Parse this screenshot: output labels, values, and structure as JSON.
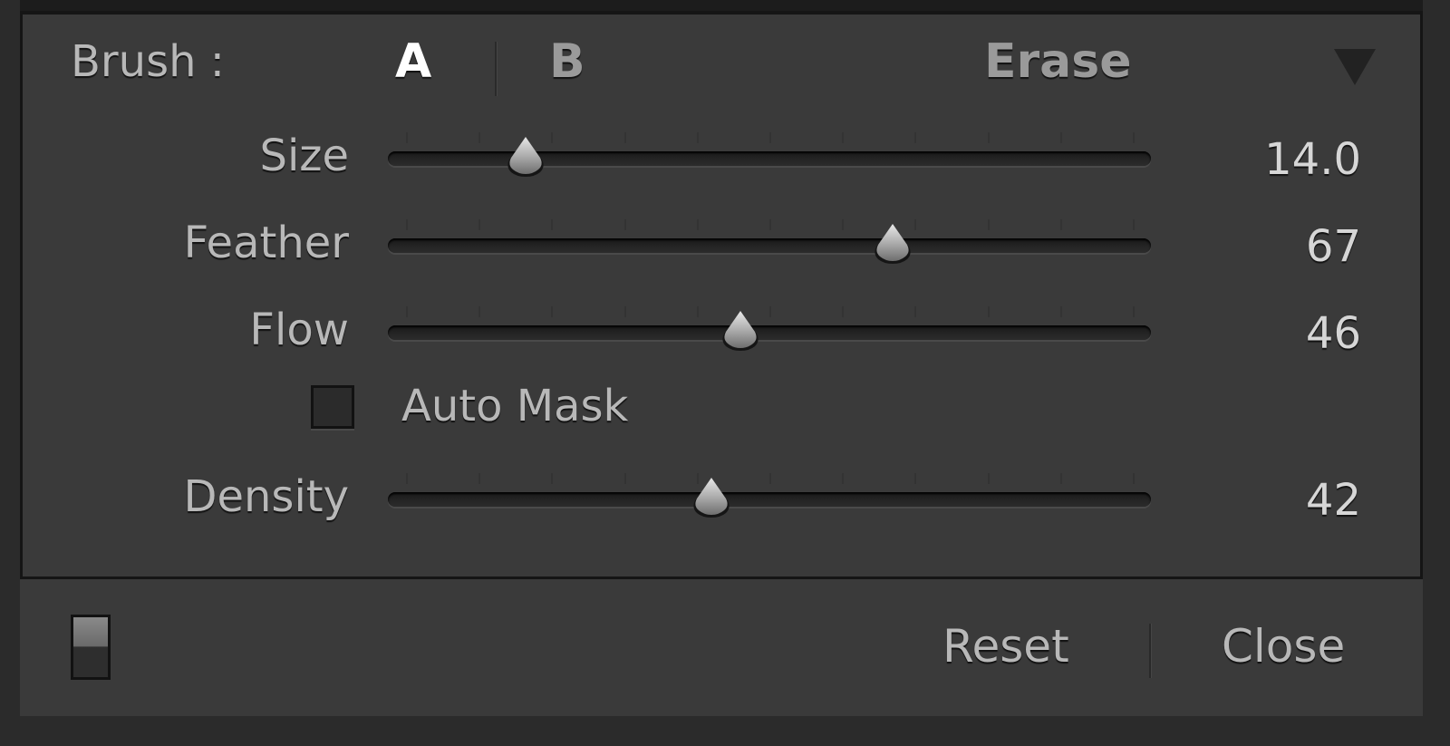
{
  "brush": {
    "label": "Brush :",
    "option_a": "A",
    "option_b": "B",
    "erase": "Erase",
    "selected": "A"
  },
  "sliders": [
    {
      "name": "size",
      "label": "Size",
      "value": "14.0",
      "fraction": 0.165
    },
    {
      "name": "feather",
      "label": "Feather",
      "value": "67",
      "fraction": 0.67
    },
    {
      "name": "flow",
      "label": "Flow",
      "value": "46",
      "fraction": 0.46
    },
    {
      "name": "density",
      "label": "Density",
      "value": "42",
      "fraction": 0.42
    }
  ],
  "auto_mask": {
    "label": "Auto Mask",
    "checked": false
  },
  "footer": {
    "reset_label": "Reset",
    "close_label": "Close"
  },
  "icons": {
    "panel_menu": "triangle-down-icon",
    "slider_thumb": "slider-thumb-icon",
    "swatch_toggle": "panel-toggle-icon"
  },
  "colors": {
    "panel_bg": "#3a3a3a",
    "text": "#b8b8b8",
    "active_text": "#ffffff",
    "border": "#151515"
  }
}
